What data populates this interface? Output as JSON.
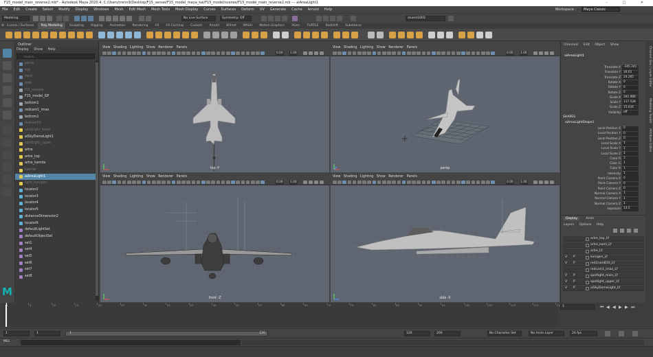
{
  "window": {
    "title": "F15_model_main_reverse2.mb* - Autodesk Maya 2020.4: C:/Users/rrenn9/Desktop/F15_sensei/F15_model_maya_kai/F15_model/scenes/F15_model_main_reverse2.mb --- aiAreaLight1"
  },
  "menubar": {
    "items": [
      "File",
      "Edit",
      "Create",
      "Select",
      "Modify",
      "Display",
      "Windows",
      "Mesh",
      "Edit Mesh",
      "Mesh Tools",
      "Mesh Display",
      "Curves",
      "Surfaces",
      "Deform",
      "UV",
      "Generate",
      "Cache",
      "Arnold",
      "Help"
    ],
    "workspace_label": "Workspace :",
    "workspace_value": "Maya Classic"
  },
  "statusline": {
    "mode": "Modeling",
    "live_surface": "No Live Surface",
    "symmetry": "Symmetry: Off",
    "render_camera": "stuent1003"
  },
  "shelf": {
    "tabs": [
      "Curves / Surfaces",
      "Poly Modeling",
      "Sculpting",
      "Rigging",
      "Animation",
      "Rendering",
      "FX",
      "FX Caching",
      "Custom",
      "Arnold",
      "Bifrost",
      "MASH",
      "Motion Graphics",
      "XGen",
      "TURTLE",
      "Redshift",
      "Substance"
    ],
    "active_tab": "Poly Modeling"
  },
  "outliner": {
    "title": "Outliner",
    "menu": [
      "Display",
      "Show",
      "Help"
    ],
    "search_placeholder": "Search...",
    "items": [
      {
        "label": "persp",
        "dim": true,
        "icon": "camera-icon"
      },
      {
        "label": "top",
        "dim": true,
        "icon": "camera-icon"
      },
      {
        "label": "front",
        "dim": true,
        "icon": "camera-icon"
      },
      {
        "label": "side",
        "dim": true,
        "icon": "camera-icon"
      },
      {
        "label": "f15_sample",
        "dim": true,
        "icon": "mesh-icon"
      },
      {
        "label": "F15_model_GP",
        "dim": false,
        "icon": "group-icon"
      },
      {
        "label": "bottom1",
        "dim": false,
        "icon": "group-icon"
      },
      {
        "label": "redcam1_imax",
        "dim": false,
        "icon": "camera-icon"
      },
      {
        "label": "bottom2",
        "dim": false,
        "icon": "group-icon"
      },
      {
        "label": "redcam01",
        "dim": true,
        "icon": "camera-icon"
      },
      {
        "label": "spotLight_lower",
        "dim": true,
        "icon": "light-icon"
      },
      {
        "label": "aiSkyDomeLight1",
        "dim": false,
        "icon": "light-icon"
      },
      {
        "label": "spotLight_upper",
        "dim": true,
        "icon": "light-icon"
      },
      {
        "label": "artre",
        "dim": false,
        "icon": "light-icon"
      },
      {
        "label": "artre_top",
        "dim": false,
        "icon": "light-icon"
      },
      {
        "label": "artre_kamite",
        "dim": false,
        "icon": "light-icon"
      },
      {
        "label": "kamite",
        "dim": true,
        "icon": "light-icon"
      },
      {
        "label": "aiAreaLight1",
        "dim": false,
        "icon": "light-icon",
        "selected": true
      },
      {
        "label": "light_kurogen",
        "dim": true,
        "icon": "light-icon"
      },
      {
        "label": "locator2",
        "dim": false,
        "icon": "locator-icon"
      },
      {
        "label": "locator3",
        "dim": false,
        "icon": "locator-icon"
      },
      {
        "label": "locator4",
        "dim": false,
        "icon": "locator-icon"
      },
      {
        "label": "locator5",
        "dim": false,
        "icon": "locator-icon"
      },
      {
        "label": "distanceDimension2",
        "dim": false,
        "icon": "locator-icon"
      },
      {
        "label": "locator6",
        "dim": false,
        "icon": "locator-icon"
      },
      {
        "label": "defaultLightSet",
        "dim": false,
        "icon": "set-icon"
      },
      {
        "label": "defaultObjectSet",
        "dim": false,
        "icon": "set-icon"
      },
      {
        "label": "set1",
        "dim": false,
        "icon": "set-icon"
      },
      {
        "label": "set4",
        "dim": false,
        "icon": "set-icon"
      },
      {
        "label": "set5",
        "dim": false,
        "icon": "set-icon"
      },
      {
        "label": "set6",
        "dim": false,
        "icon": "set-icon"
      },
      {
        "label": "set7",
        "dim": false,
        "icon": "set-icon"
      },
      {
        "label": "set8",
        "dim": false,
        "icon": "set-icon"
      }
    ]
  },
  "viewports": {
    "menu": [
      "View",
      "Shading",
      "Lighting",
      "Show",
      "Renderer",
      "Panels"
    ],
    "values": {
      "a": "0.00",
      "b": "1.00"
    },
    "top": {
      "camera": "top -Y"
    },
    "persp": {
      "camera": "persp"
    },
    "front": {
      "camera": "front -Z"
    },
    "side": {
      "camera": "side -X"
    }
  },
  "channelbox": {
    "tabs": [
      "Channels",
      "Edit",
      "Object",
      "Show"
    ],
    "object": "aiAreaLight1",
    "attrs": [
      {
        "label": "Translate X",
        "value": "-345.241"
      },
      {
        "label": "Translate Y",
        "value": "39.01"
      },
      {
        "label": "Translate Z",
        "value": "24.265"
      },
      {
        "label": "Rotate X",
        "value": "0"
      },
      {
        "label": "Rotate Y",
        "value": "0"
      },
      {
        "label": "Rotate Z",
        "value": "0"
      },
      {
        "label": "Scale X",
        "value": "341.086"
      },
      {
        "label": "Scale Y",
        "value": "117.528"
      },
      {
        "label": "Scale Z",
        "value": "15.616"
      },
      {
        "label": "Visibility",
        "value": "off"
      }
    ],
    "shapes_header": "SHAPES",
    "shape_name": "aiAreaLightShape1",
    "shape_attrs": [
      {
        "label": "Local Position X",
        "value": "0"
      },
      {
        "label": "Local Position Y",
        "value": "0"
      },
      {
        "label": "Local Position Z",
        "value": "0"
      },
      {
        "label": "Local Scale X",
        "value": "1"
      },
      {
        "label": "Local Scale Y",
        "value": "1"
      },
      {
        "label": "Local Scale Z",
        "value": "1"
      },
      {
        "label": "Color R",
        "value": "1"
      },
      {
        "label": "Color G",
        "value": "1"
      },
      {
        "label": "Color B",
        "value": "1"
      },
      {
        "label": "Intensity",
        "value": "1"
      },
      {
        "label": "Point Camera X",
        "value": "0"
      },
      {
        "label": "Point Camera Y",
        "value": "0"
      },
      {
        "label": "Point Camera Z",
        "value": "0"
      },
      {
        "label": "Normal Camera X",
        "value": "1"
      },
      {
        "label": "Normal Camera Y",
        "value": "1"
      },
      {
        "label": "Normal Camera Z",
        "value": "1"
      },
      {
        "label": "exposure",
        "value": "13.5"
      }
    ]
  },
  "layers": {
    "tabs": [
      "Display",
      "Anim"
    ],
    "menu": [
      "Layers",
      "Options",
      "Help"
    ],
    "rows": [
      {
        "v": "",
        "p": "",
        "name": "artre_top_LY"
      },
      {
        "v": "",
        "p": "",
        "name": "artre_kami_LY"
      },
      {
        "v": "",
        "p": "",
        "name": "artre_LY"
      },
      {
        "v": "V",
        "p": "P",
        "name": "kurogen_LY"
      },
      {
        "v": "V",
        "p": "P",
        "name": "red2camB10_LY"
      },
      {
        "v": "",
        "p": "",
        "name": "redcam1_imax_LY"
      },
      {
        "v": "V",
        "p": "P",
        "name": "spotlight_main_LY"
      },
      {
        "v": "V",
        "p": "P",
        "name": "spotlight_upper_LY"
      },
      {
        "v": "V",
        "p": "P",
        "name": "aiSkyDomeLight_LY"
      }
    ]
  },
  "timeslider": {
    "ticks": [
      "1",
      "5",
      "10",
      "15",
      "20",
      "25",
      "30",
      "35",
      "40",
      "45",
      "50",
      "55",
      "60",
      "65",
      "70",
      "75",
      "80",
      "85",
      "90",
      "95",
      "100",
      "105",
      "110",
      "115",
      "120"
    ],
    "current_frame": "1"
  },
  "range": {
    "start": "1",
    "start_inner": "1",
    "slider_start": "1",
    "slider_end": "120",
    "end_inner": "120",
    "end": "200",
    "character_set": "No Character Set",
    "anim_layer": "No Anim Layer",
    "fps": "24 fps"
  },
  "cmdline": {
    "label": "MEL"
  },
  "sidetabs": [
    "Channel Box / Layer Editor",
    "Modeling Toolkit",
    "Attribute Editor"
  ],
  "colors": {
    "selection": "#5285a6",
    "viewport_bg": "#5e6570",
    "model": "#b9b9b9",
    "maya_logo": "#10b3b0"
  }
}
